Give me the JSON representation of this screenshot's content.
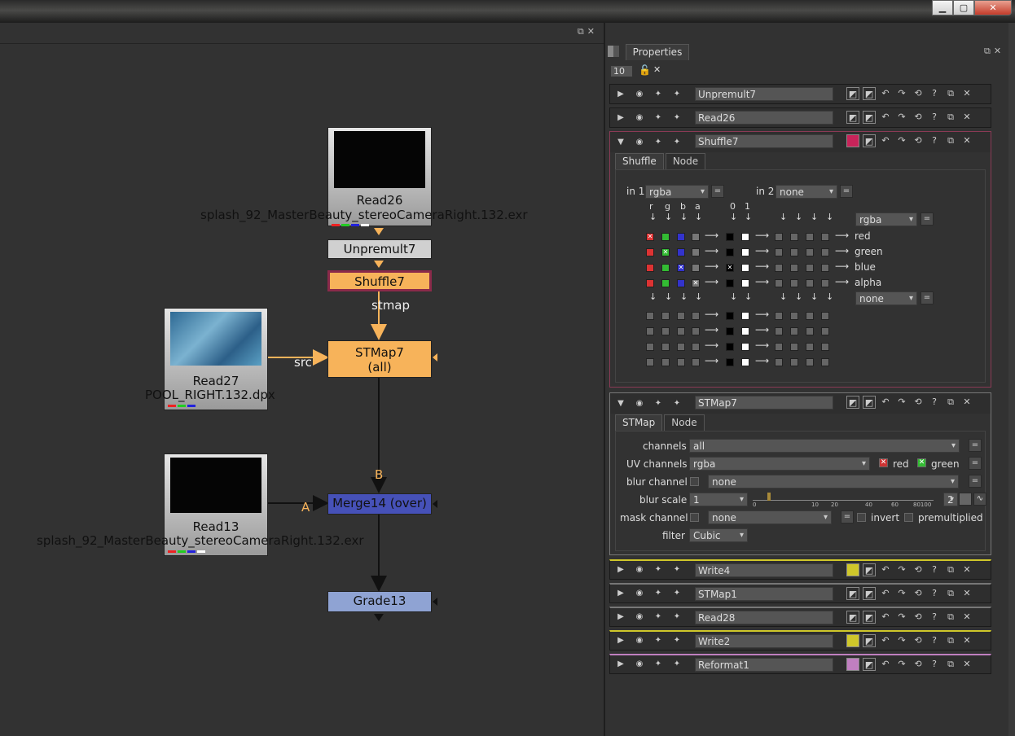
{
  "window": {
    "min": "▁",
    "max": "▢",
    "close": "✕"
  },
  "graph": {
    "nodes": {
      "read26": {
        "name": "Read26",
        "file": "splash_92_MasterBeauty_stereoCameraRight.132.exr"
      },
      "unpremult7": {
        "name": "Unpremult7"
      },
      "shuffle7": {
        "name": "Shuffle7"
      },
      "read27": {
        "name": "Read27",
        "file": "POOL_RIGHT.132.dpx"
      },
      "stmap7": {
        "name": "STMap7",
        "sub": "(all)"
      },
      "read13": {
        "name": "Read13",
        "file": "splash_92_MasterBeauty_stereoCameraRight.132.exr"
      },
      "merge14": {
        "name": "Merge14 (over)"
      },
      "grade13": {
        "name": "Grade13"
      }
    },
    "edge_labels": {
      "stmap": "stmap",
      "src": "src",
      "b": "B",
      "a": "A"
    }
  },
  "properties": {
    "tab": "Properties",
    "max_panels": "10",
    "panels_collapsed_top": [
      "Unpremult7",
      "Read26"
    ],
    "shuffle": {
      "name": "Shuffle7",
      "tabs": [
        "Shuffle",
        "Node"
      ],
      "in1_label": "in 1",
      "in1_value": "rgba",
      "in2_label": "in 2",
      "in2_value": "none",
      "col_headers": [
        "r",
        "g",
        "b",
        "a",
        "0",
        "1"
      ],
      "out1_value": "rgba",
      "out2_value": "none",
      "out_channels": [
        "red",
        "green",
        "blue",
        "alpha"
      ],
      "eq": "="
    },
    "stmap": {
      "name": "STMap7",
      "tabs": [
        "STMap",
        "Node"
      ],
      "channels_label": "channels",
      "channels_value": "all",
      "uv_label": "UV channels",
      "uv_value": "rgba",
      "uv_red": "red",
      "uv_green": "green",
      "blur_channel_label": "blur channel",
      "blur_channel_value": "none",
      "blur_scale_label": "blur scale",
      "blur_scale_value": "1",
      "slider_ticks": [
        "0",
        "10",
        "20",
        "40",
        "60",
        "80100"
      ],
      "blur_scale_extra": "2",
      "mask_label": "mask channel",
      "mask_value": "none",
      "invert_label": "invert",
      "premult_label": "premultiplied",
      "filter_label": "filter",
      "filter_value": "Cubic"
    },
    "panels_collapsed_bottom": [
      "Write4",
      "STMap1",
      "Read28",
      "Write2",
      "Reformat1"
    ]
  },
  "colors": {
    "node_orange": "#f7b35a",
    "node_grey": "#d0d0d0",
    "merge_blue": "#4651b8",
    "grade_blue": "#8fa3d3",
    "edge_orange": "#f7b35a",
    "shuffle_border": "#c8245a",
    "write_yellow": "#cfc72a",
    "reformat_purple": "#c07fc0"
  }
}
